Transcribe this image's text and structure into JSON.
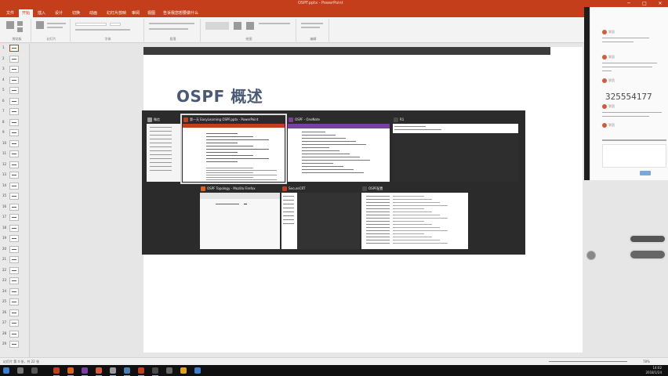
{
  "window": {
    "title": "OSPF.pptx - PowerPoint"
  },
  "ribbon": {
    "tabs": [
      "文件",
      "开始",
      "插入",
      "设计",
      "切换",
      "动画",
      "幻灯片放映",
      "审阅",
      "视图",
      "告诉我您想要做什么"
    ],
    "active_tab": "开始",
    "groups": [
      "剪贴板",
      "幻灯片",
      "字体",
      "段落",
      "绘图",
      "编辑"
    ]
  },
  "thumbnails": [
    "1",
    "2",
    "3",
    "4",
    "5",
    "6",
    "7",
    "8",
    "9",
    "10",
    "11",
    "12",
    "13",
    "14",
    "15",
    "16",
    "17",
    "18",
    "19",
    "20",
    "21",
    "22",
    "23",
    "24",
    "25",
    "26",
    "27",
    "28",
    "29"
  ],
  "slide": {
    "title": "OSPF 概述"
  },
  "switcher": {
    "windows": [
      {
        "title": "微信",
        "icon_color": "#9a9a9a"
      },
      {
        "title": "第一天 EasyLearning OSPF.pptx - PowerPoint",
        "icon_color": "#c43e1c"
      },
      {
        "title": "OSPF - OneNote",
        "icon_color": "#7a3fa0"
      },
      {
        "title": "R1",
        "icon_color": "#4a4a4a"
      },
      {
        "title": "OSPF Topology - Mozilla Firefox",
        "icon_color": "#e06020"
      },
      {
        "title": "SecureCRT",
        "icon_color": "#c43e1c"
      },
      {
        "title": "OSPF配置",
        "icon_color": "#4a4a4a"
      }
    ]
  },
  "chat": {
    "number": "325554177",
    "messages": [
      {
        "nick": "学员"
      },
      {
        "nick": "学员"
      },
      {
        "nick": "学员"
      },
      {
        "nick": "学员"
      },
      {
        "nick": "学员"
      }
    ]
  },
  "statusbar": {
    "slide_info": "幻灯片 第 4 张，共 22 张",
    "zoom": "78%"
  },
  "taskbar": {
    "time": "14:02",
    "date": "2018/1/24"
  }
}
